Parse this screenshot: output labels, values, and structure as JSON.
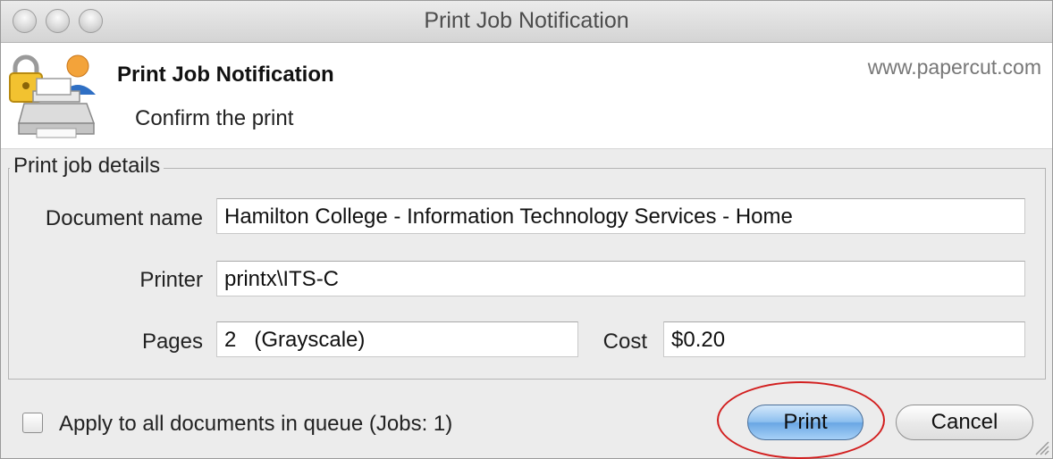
{
  "window": {
    "title": "Print Job Notification"
  },
  "header": {
    "title": "Print Job Notification",
    "subtitle": "Confirm the print",
    "link": "www.papercut.com",
    "icon": "printer-lock-user-icon"
  },
  "details": {
    "legend": "Print job details",
    "document_name_label": "Document name",
    "document_name_value": "Hamilton College - Information Technology Services - Home",
    "printer_label": "Printer",
    "printer_value": "printx\\ITS-C",
    "pages_label": "Pages",
    "pages_value": "2   (Grayscale)",
    "cost_label": "Cost",
    "cost_value": "$0.20"
  },
  "footer": {
    "apply_all_label": "Apply to all documents in queue (Jobs: 1)",
    "apply_all_checked": false,
    "print_label": "Print",
    "cancel_label": "Cancel"
  },
  "colors": {
    "print_button_accent": "#6aa7e4",
    "annotation_circle": "#d21f1f"
  }
}
